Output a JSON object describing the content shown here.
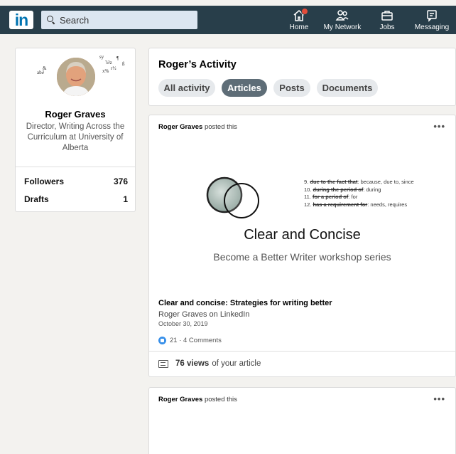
{
  "nav": {
    "logo_text": "in",
    "search_placeholder": "Search",
    "items": [
      {
        "label": "Home",
        "icon": "home-icon",
        "has_badge": true
      },
      {
        "label": "My Network",
        "icon": "network-icon"
      },
      {
        "label": "Jobs",
        "icon": "briefcase-icon"
      },
      {
        "label": "Messaging",
        "icon": "messaging-icon"
      }
    ],
    "colors": {
      "bar": "#283e4a",
      "brand": "#0073b1",
      "badge": "#e34c3a"
    }
  },
  "profile": {
    "name": "Roger Graves",
    "headline": "Director, Writing Across the Curriculum at University of Alberta",
    "stats": [
      {
        "label": "Followers",
        "value": "376"
      },
      {
        "label": "Drafts",
        "value": "1"
      }
    ]
  },
  "activity": {
    "title": "Roger’s Activity",
    "tabs": [
      {
        "label": "All activity",
        "active": false
      },
      {
        "label": "Articles",
        "active": true
      },
      {
        "label": "Posts",
        "active": false
      },
      {
        "label": "Documents",
        "active": false
      }
    ]
  },
  "posts": [
    {
      "author": "Roger Graves",
      "action": "posted this",
      "more": "•••",
      "image": {
        "rules": [
          {
            "num": "9.",
            "phrase": "due to the fact that",
            "replacement": ": because, due to, since"
          },
          {
            "num": "10.",
            "phrase": "during the period of",
            "replacement": ": during"
          },
          {
            "num": "11.",
            "phrase": "for a period of",
            "replacement": ": for"
          },
          {
            "num": "12.",
            "phrase": "has a requirement for",
            "replacement": ": needs, requires"
          }
        ],
        "headline": "Clear and Concise",
        "subline": "Become a Better Writer workshop series"
      },
      "article_title": "Clear and concise: Strategies for writing better",
      "article_source": "Roger Graves on LinkedIn",
      "article_date": "October 30, 2019",
      "social": "21 · 4 Comments",
      "views_count": "76 views",
      "views_suffix": "of your article"
    },
    {
      "author": "Roger Graves",
      "action": "posted this",
      "more": "•••"
    }
  ]
}
